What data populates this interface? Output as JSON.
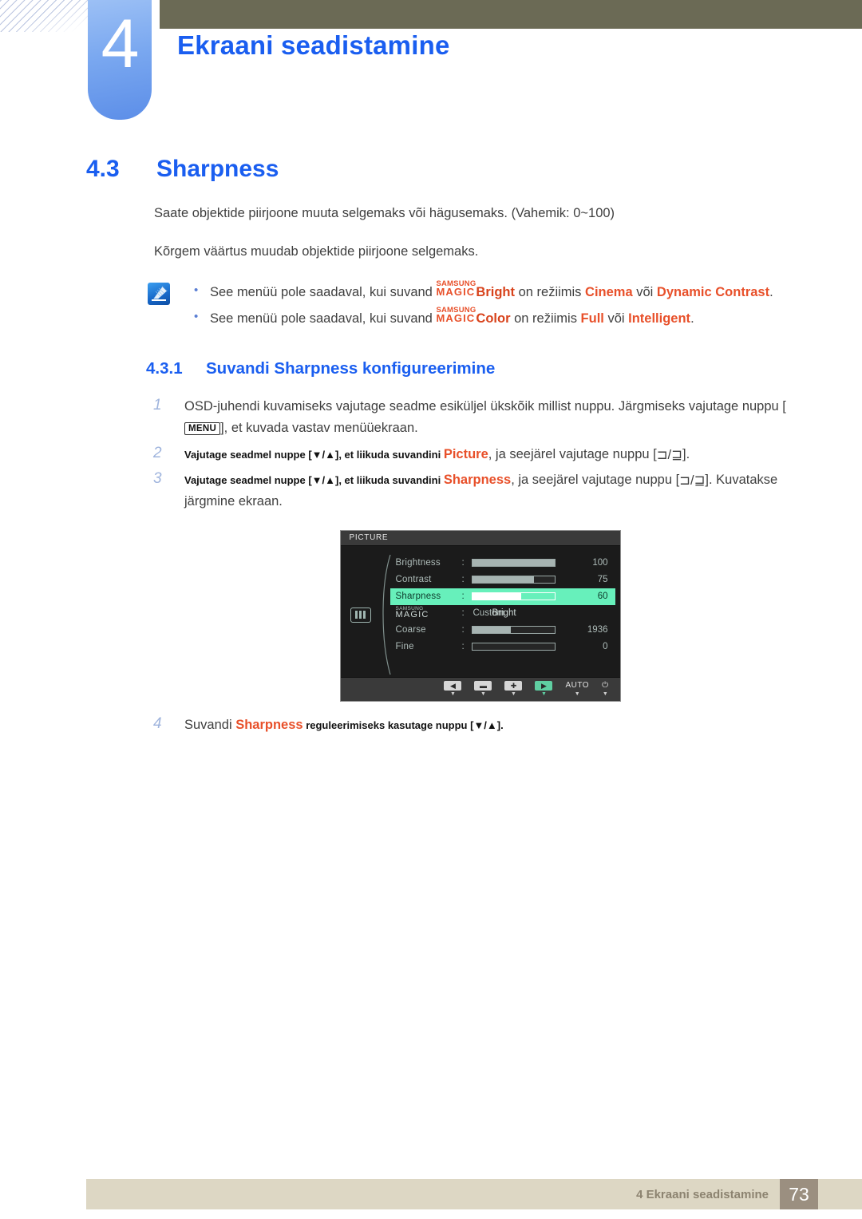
{
  "header": {
    "chapter_number": "4",
    "chapter_title": "Ekraani seadistamine"
  },
  "section": {
    "number": "4.3",
    "title": "Sharpness",
    "paragraph_1": "Saate objektide piirjoone muuta selgemaks või hägusemaks. (Vahemik: 0~100)",
    "paragraph_2": "Kõrgem väärtus muudab objektide piirjoone selgemaks."
  },
  "note": {
    "icon": "note-pencil-icon",
    "items": [
      {
        "lead": "See menüü pole saadaval, kui suvand ",
        "magic_top": "SAMSUNG",
        "magic_bottom": "MAGIC",
        "magic_suffix": "Bright",
        "mid": " on režiimis ",
        "kw1": "Cinema",
        "sep": " või ",
        "kw2": "Dynamic Contrast",
        "tail": "."
      },
      {
        "lead": "See menüü pole saadaval, kui suvand ",
        "magic_top": "SAMSUNG",
        "magic_bottom": "MAGIC",
        "magic_suffix": "Color",
        "mid": " on režiimis ",
        "kw1": "Full",
        "sep": " või ",
        "kw2": "Intelligent",
        "tail": "."
      }
    ]
  },
  "subsection": {
    "number": "4.3.1",
    "title": "Suvandi Sharpness konfigureerimine"
  },
  "steps": [
    {
      "index": "1",
      "part_a": "OSD-juhendi kuvamiseks vajutage seadme esiküljel ükskõik millist nuppu. Järgmiseks vajutage nuppu [",
      "button": "MENU",
      "part_b": "], et kuvada vastav menüüekraan."
    },
    {
      "index": "2",
      "part_a": "Vajutage seadmel nuppe [▼/▲], et liikuda suvandini ",
      "keyword": "Picture",
      "part_b": ", ja seejärel vajutage nuppu [",
      "glyph": "⊐/⊒",
      "part_c": "]."
    },
    {
      "index": "3",
      "part_a": "Vajutage seadmel nuppe [▼/▲], et liikuda suvandini ",
      "keyword": "Sharpness",
      "part_b": ", ja seejärel vajutage nuppu [",
      "glyph": "⊐/⊒",
      "part_c": "]. Kuvatakse järgmine ekraan."
    },
    {
      "index": "4",
      "part_a": "Suvandi ",
      "keyword": "Sharpness",
      "part_b": " reguleerimiseks kasutage nuppu [▼/▲]."
    }
  ],
  "osd": {
    "title": "PICTURE",
    "menu_icon": "picture-bars-icon",
    "rows": [
      {
        "label": "Brightness",
        "type": "bar",
        "fill_percent": 100,
        "value": "100",
        "selected": false
      },
      {
        "label": "Contrast",
        "type": "bar",
        "fill_percent": 75,
        "value": "75",
        "selected": false
      },
      {
        "label": "Sharpness",
        "type": "bar",
        "fill_percent": 60,
        "value": "60",
        "selected": true
      },
      {
        "label": "MAGIC Bright",
        "magic_top": "SAMSUNG",
        "magic_bottom": "MAGIC",
        "magic_suffix": " Bright",
        "type": "text",
        "value": "Custom",
        "selected": false
      },
      {
        "label": "Coarse",
        "type": "bar",
        "fill_percent": 47,
        "value": "1936",
        "selected": false
      },
      {
        "label": "Fine",
        "type": "bar",
        "fill_percent": 0,
        "value": "0",
        "selected": false
      }
    ],
    "footer_buttons": [
      {
        "name": "left-arrow-button",
        "glyph": "◀",
        "style": "cap"
      },
      {
        "name": "minus-button",
        "glyph": "▬",
        "style": "cap"
      },
      {
        "name": "plus-button",
        "glyph": "✚",
        "style": "cap"
      },
      {
        "name": "right-arrow-button",
        "glyph": "▶",
        "style": "cap-green"
      },
      {
        "name": "auto-button",
        "glyph": "AUTO",
        "style": "plain"
      },
      {
        "name": "power-button",
        "glyph": "⏻",
        "style": "plain"
      }
    ],
    "selected_color": "#67f0bb"
  },
  "footer": {
    "text": "4 Ekraani seadistamine",
    "page_number": "73"
  }
}
